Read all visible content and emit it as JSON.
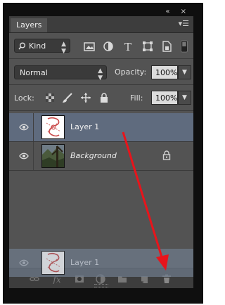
{
  "panel": {
    "tab_label": "Layers",
    "window_controls": "«  ×",
    "menu_glyph": "▾☰"
  },
  "filter": {
    "kind_label": "Kind",
    "icons": [
      "image-filter-icon",
      "adjustment-filter-icon",
      "type-filter-icon",
      "shape-filter-icon",
      "smart-object-filter-icon",
      "filter-toggle-icon"
    ]
  },
  "blend": {
    "mode": "Normal",
    "opacity_label": "Opacity:",
    "opacity_value": "100%"
  },
  "lock": {
    "label": "Lock:",
    "icons": [
      "lock-transparent-icon",
      "lock-image-icon",
      "lock-position-icon",
      "lock-all-icon"
    ],
    "fill_label": "Fill:",
    "fill_value": "100%"
  },
  "layers": [
    {
      "name": "Layer 1",
      "selected": true,
      "locked": false
    },
    {
      "name": "Background",
      "selected": false,
      "locked": true
    }
  ],
  "drag_preview": {
    "name": "Layer 1"
  },
  "footer_icons": [
    "link-layers-icon",
    "add-style-icon",
    "add-mask-icon",
    "adjustment-layer-icon",
    "new-group-icon",
    "new-layer-icon",
    "delete-layer-icon"
  ],
  "annotation": {
    "color": "#e8141b"
  }
}
